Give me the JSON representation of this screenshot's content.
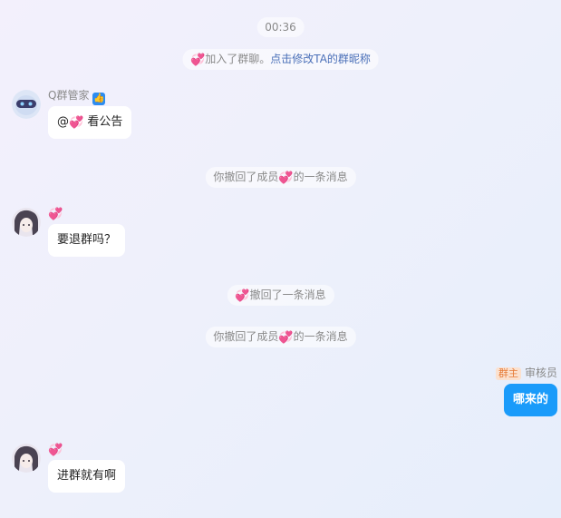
{
  "timestamp": "00:36",
  "heart_emoji": "💞",
  "system_join": {
    "text": "加入了群聊。",
    "link": "点击修改TA的群昵称"
  },
  "messages": [
    {
      "sender_name": "Q群管家",
      "prefix": "@",
      "text": "看公告"
    },
    {
      "text": "要退群吗？"
    },
    {
      "role": "群主",
      "sender_name": "审核员",
      "text": "哪来的"
    },
    {
      "text": "进群就有啊"
    }
  ],
  "system_recall_1": {
    "before": "你撤回了成员",
    "after": "的一条消息"
  },
  "system_recall_2": {
    "after": "撤回了一条消息"
  },
  "system_recall_3": {
    "before": "你撤回了成员",
    "after": "的一条消息"
  },
  "colors": {
    "own_bubble": "#1a9bfa",
    "link": "#4a6fb8",
    "role_badge_bg": "#fbe1cf",
    "role_badge_text": "#e67a36"
  }
}
